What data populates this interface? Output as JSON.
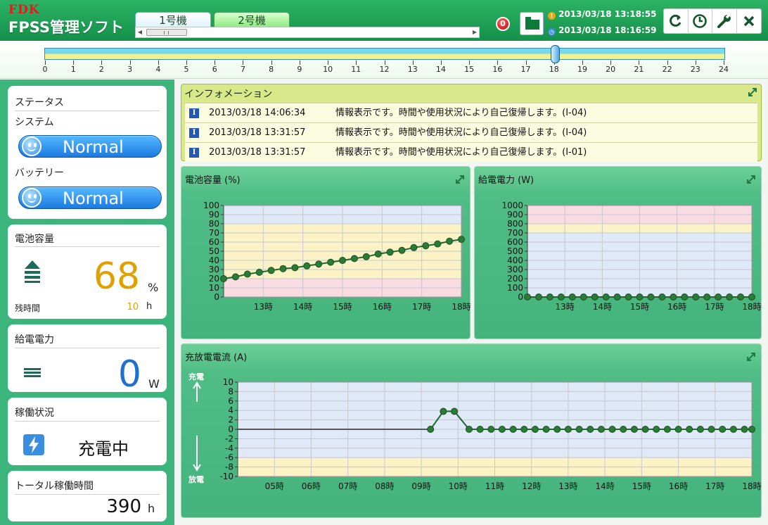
{
  "header": {
    "brand": "FDK",
    "title": "FPSS管理ソフト",
    "tabs": [
      "1号機",
      "2号機"
    ],
    "alarm_count": "0",
    "time_primary": "2013/03/18 13:18:55",
    "time_secondary": "2013/03/18 18:16:59",
    "toolbar": [
      {
        "name": "refresh-icon",
        "glyph": "C"
      },
      {
        "name": "history-clock-icon",
        "glyph": "◷"
      },
      {
        "name": "wrench-settings-icon",
        "glyph": "🔧"
      },
      {
        "name": "close-icon",
        "glyph": "✕"
      }
    ]
  },
  "timeline": {
    "labels": [
      "0",
      "1",
      "2",
      "3",
      "4",
      "5",
      "6",
      "7",
      "8",
      "9",
      "10",
      "11",
      "12",
      "13",
      "14",
      "15",
      "16",
      "17",
      "18",
      "19",
      "20",
      "21",
      "22",
      "23",
      "24"
    ],
    "current_hour": 18
  },
  "sidebar": {
    "status": {
      "title": "ステータス",
      "system_label": "システム",
      "system_value": "Normal",
      "battery_label": "バッテリー",
      "battery_value": "Normal"
    },
    "capacity": {
      "title": "電池容量",
      "value": "68",
      "unit": "%",
      "remaining_label": "残時間",
      "remaining_value": "10",
      "remaining_unit": "h"
    },
    "supply": {
      "title": "給電電力",
      "value": "0",
      "unit": "W"
    },
    "operation": {
      "title": "稼働状況",
      "value": "充電中"
    },
    "total_time": {
      "title": "トータル稼働時間",
      "value": "390",
      "unit": "h"
    }
  },
  "info": {
    "title": "インフォメーション",
    "rows": [
      {
        "time": "2013/03/18 14:06:34",
        "message": "情報表示です。時間や使用状況により自己復帰します。(I-04)"
      },
      {
        "time": "2013/03/18 13:31:57",
        "message": "情報表示です。時間や使用状況により自己復帰します。(I-04)"
      },
      {
        "time": "2013/03/18 13:31:57",
        "message": "情報表示です。時間や使用状況により自己復帰します。(I-01)"
      }
    ]
  },
  "colors": {
    "accent_green": "#2bb06a",
    "warn_yellow": "#f2a400",
    "capacity_value": "#e0a000",
    "power_value": "#1e6fd0"
  },
  "chart_data": [
    {
      "type": "line",
      "title": "電池容量 (%)",
      "x_tick_labels": [
        "13時",
        "14時",
        "15時",
        "16時",
        "17時",
        "18時"
      ],
      "xlim": [
        12,
        18
      ],
      "ylim": [
        0,
        100
      ],
      "y_ticks": [
        0,
        10,
        20,
        30,
        40,
        50,
        60,
        70,
        80,
        90,
        100
      ],
      "bands": [
        {
          "from": 0,
          "to": 20,
          "color": "#f9dce2"
        },
        {
          "from": 20,
          "to": 80,
          "color": "#fbf3c6"
        },
        {
          "from": 80,
          "to": 100,
          "color": "#dfe9f8"
        }
      ],
      "x": [
        12.0,
        12.3,
        12.6,
        12.9,
        13.2,
        13.5,
        13.8,
        14.1,
        14.4,
        14.7,
        15.0,
        15.3,
        15.6,
        15.9,
        16.2,
        16.5,
        16.8,
        17.1,
        17.4,
        17.7,
        18.0
      ],
      "y": [
        20,
        22,
        25,
        27,
        29,
        31,
        32,
        34,
        36,
        38,
        40,
        42,
        44,
        47,
        49,
        51,
        54,
        56,
        58,
        61,
        63
      ]
    },
    {
      "type": "line",
      "title": "給電電力 (W)",
      "x_tick_labels": [
        "13時",
        "14時",
        "15時",
        "16時",
        "17時",
        "18時"
      ],
      "xlim": [
        12,
        18
      ],
      "ylim": [
        0,
        1000
      ],
      "y_ticks": [
        0,
        100,
        200,
        300,
        400,
        500,
        600,
        700,
        800,
        900,
        1000
      ],
      "bands": [
        {
          "from": 0,
          "to": 700,
          "color": "#dfe9f8"
        },
        {
          "from": 700,
          "to": 800,
          "color": "#fbf3c6"
        },
        {
          "from": 800,
          "to": 1000,
          "color": "#f9dce2"
        }
      ],
      "x": [
        12.0,
        12.3,
        12.6,
        12.9,
        13.2,
        13.5,
        13.8,
        14.1,
        14.4,
        14.7,
        15.0,
        15.3,
        15.6,
        15.9,
        16.2,
        16.5,
        16.8,
        17.1,
        17.4,
        17.7,
        18.0
      ],
      "y": [
        0,
        0,
        0,
        0,
        0,
        0,
        0,
        0,
        0,
        0,
        0,
        0,
        0,
        0,
        0,
        0,
        0,
        0,
        0,
        0,
        0
      ]
    },
    {
      "type": "line",
      "title": "充放電電流 (A)",
      "x_tick_labels": [
        "05時",
        "06時",
        "07時",
        "08時",
        "09時",
        "10時",
        "11時",
        "12時",
        "13時",
        "14時",
        "15時",
        "16時",
        "17時",
        "18時"
      ],
      "xlim": [
        4,
        18
      ],
      "ylim": [
        -10,
        10
      ],
      "y_ticks": [
        -10,
        -8,
        -6,
        -4,
        -2,
        0,
        2,
        4,
        6,
        8,
        10
      ],
      "charge_label": "充電",
      "discharge_label": "放電",
      "bands": [
        {
          "from": -10,
          "to": -6,
          "color": "#fbf3c6"
        },
        {
          "from": -6,
          "to": 10,
          "color": "#dfe9f8"
        }
      ],
      "line_only_x": [
        4.0,
        9.25
      ],
      "line_only_y": [
        0,
        0
      ],
      "x": [
        9.25,
        9.6,
        9.9,
        10.3,
        10.6,
        10.9,
        11.2,
        11.5,
        11.8,
        12.1,
        12.4,
        12.7,
        13.0,
        13.3,
        13.6,
        13.9,
        14.2,
        14.5,
        14.8,
        15.1,
        15.4,
        15.7,
        16.0,
        16.3,
        16.6,
        16.9,
        17.2,
        17.5,
        17.8,
        18.0
      ],
      "y": [
        0,
        3.8,
        3.8,
        0,
        0,
        0,
        0,
        0,
        0,
        0,
        0,
        0,
        0,
        0,
        0,
        0,
        0,
        0,
        0,
        0,
        0,
        0,
        0,
        0,
        0,
        0,
        0,
        0,
        0,
        0
      ]
    }
  ]
}
